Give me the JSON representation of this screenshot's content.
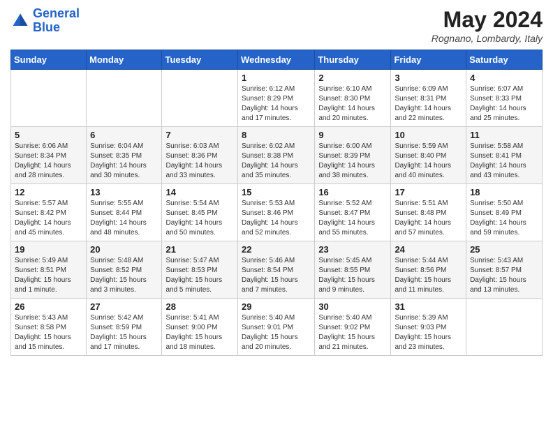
{
  "header": {
    "logo_line1": "General",
    "logo_line2": "Blue",
    "month_year": "May 2024",
    "location": "Rognano, Lombardy, Italy"
  },
  "weekdays": [
    "Sunday",
    "Monday",
    "Tuesday",
    "Wednesday",
    "Thursday",
    "Friday",
    "Saturday"
  ],
  "weeks": [
    [
      {
        "day": "",
        "sunrise": "",
        "sunset": "",
        "daylight": ""
      },
      {
        "day": "",
        "sunrise": "",
        "sunset": "",
        "daylight": ""
      },
      {
        "day": "",
        "sunrise": "",
        "sunset": "",
        "daylight": ""
      },
      {
        "day": "1",
        "sunrise": "Sunrise: 6:12 AM",
        "sunset": "Sunset: 8:29 PM",
        "daylight": "Daylight: 14 hours and 17 minutes."
      },
      {
        "day": "2",
        "sunrise": "Sunrise: 6:10 AM",
        "sunset": "Sunset: 8:30 PM",
        "daylight": "Daylight: 14 hours and 20 minutes."
      },
      {
        "day": "3",
        "sunrise": "Sunrise: 6:09 AM",
        "sunset": "Sunset: 8:31 PM",
        "daylight": "Daylight: 14 hours and 22 minutes."
      },
      {
        "day": "4",
        "sunrise": "Sunrise: 6:07 AM",
        "sunset": "Sunset: 8:33 PM",
        "daylight": "Daylight: 14 hours and 25 minutes."
      }
    ],
    [
      {
        "day": "5",
        "sunrise": "Sunrise: 6:06 AM",
        "sunset": "Sunset: 8:34 PM",
        "daylight": "Daylight: 14 hours and 28 minutes."
      },
      {
        "day": "6",
        "sunrise": "Sunrise: 6:04 AM",
        "sunset": "Sunset: 8:35 PM",
        "daylight": "Daylight: 14 hours and 30 minutes."
      },
      {
        "day": "7",
        "sunrise": "Sunrise: 6:03 AM",
        "sunset": "Sunset: 8:36 PM",
        "daylight": "Daylight: 14 hours and 33 minutes."
      },
      {
        "day": "8",
        "sunrise": "Sunrise: 6:02 AM",
        "sunset": "Sunset: 8:38 PM",
        "daylight": "Daylight: 14 hours and 35 minutes."
      },
      {
        "day": "9",
        "sunrise": "Sunrise: 6:00 AM",
        "sunset": "Sunset: 8:39 PM",
        "daylight": "Daylight: 14 hours and 38 minutes."
      },
      {
        "day": "10",
        "sunrise": "Sunrise: 5:59 AM",
        "sunset": "Sunset: 8:40 PM",
        "daylight": "Daylight: 14 hours and 40 minutes."
      },
      {
        "day": "11",
        "sunrise": "Sunrise: 5:58 AM",
        "sunset": "Sunset: 8:41 PM",
        "daylight": "Daylight: 14 hours and 43 minutes."
      }
    ],
    [
      {
        "day": "12",
        "sunrise": "Sunrise: 5:57 AM",
        "sunset": "Sunset: 8:42 PM",
        "daylight": "Daylight: 14 hours and 45 minutes."
      },
      {
        "day": "13",
        "sunrise": "Sunrise: 5:55 AM",
        "sunset": "Sunset: 8:44 PM",
        "daylight": "Daylight: 14 hours and 48 minutes."
      },
      {
        "day": "14",
        "sunrise": "Sunrise: 5:54 AM",
        "sunset": "Sunset: 8:45 PM",
        "daylight": "Daylight: 14 hours and 50 minutes."
      },
      {
        "day": "15",
        "sunrise": "Sunrise: 5:53 AM",
        "sunset": "Sunset: 8:46 PM",
        "daylight": "Daylight: 14 hours and 52 minutes."
      },
      {
        "day": "16",
        "sunrise": "Sunrise: 5:52 AM",
        "sunset": "Sunset: 8:47 PM",
        "daylight": "Daylight: 14 hours and 55 minutes."
      },
      {
        "day": "17",
        "sunrise": "Sunrise: 5:51 AM",
        "sunset": "Sunset: 8:48 PM",
        "daylight": "Daylight: 14 hours and 57 minutes."
      },
      {
        "day": "18",
        "sunrise": "Sunrise: 5:50 AM",
        "sunset": "Sunset: 8:49 PM",
        "daylight": "Daylight: 14 hours and 59 minutes."
      }
    ],
    [
      {
        "day": "19",
        "sunrise": "Sunrise: 5:49 AM",
        "sunset": "Sunset: 8:51 PM",
        "daylight": "Daylight: 15 hours and 1 minute."
      },
      {
        "day": "20",
        "sunrise": "Sunrise: 5:48 AM",
        "sunset": "Sunset: 8:52 PM",
        "daylight": "Daylight: 15 hours and 3 minutes."
      },
      {
        "day": "21",
        "sunrise": "Sunrise: 5:47 AM",
        "sunset": "Sunset: 8:53 PM",
        "daylight": "Daylight: 15 hours and 5 minutes."
      },
      {
        "day": "22",
        "sunrise": "Sunrise: 5:46 AM",
        "sunset": "Sunset: 8:54 PM",
        "daylight": "Daylight: 15 hours and 7 minutes."
      },
      {
        "day": "23",
        "sunrise": "Sunrise: 5:45 AM",
        "sunset": "Sunset: 8:55 PM",
        "daylight": "Daylight: 15 hours and 9 minutes."
      },
      {
        "day": "24",
        "sunrise": "Sunrise: 5:44 AM",
        "sunset": "Sunset: 8:56 PM",
        "daylight": "Daylight: 15 hours and 11 minutes."
      },
      {
        "day": "25",
        "sunrise": "Sunrise: 5:43 AM",
        "sunset": "Sunset: 8:57 PM",
        "daylight": "Daylight: 15 hours and 13 minutes."
      }
    ],
    [
      {
        "day": "26",
        "sunrise": "Sunrise: 5:43 AM",
        "sunset": "Sunset: 8:58 PM",
        "daylight": "Daylight: 15 hours and 15 minutes."
      },
      {
        "day": "27",
        "sunrise": "Sunrise: 5:42 AM",
        "sunset": "Sunset: 8:59 PM",
        "daylight": "Daylight: 15 hours and 17 minutes."
      },
      {
        "day": "28",
        "sunrise": "Sunrise: 5:41 AM",
        "sunset": "Sunset: 9:00 PM",
        "daylight": "Daylight: 15 hours and 18 minutes."
      },
      {
        "day": "29",
        "sunrise": "Sunrise: 5:40 AM",
        "sunset": "Sunset: 9:01 PM",
        "daylight": "Daylight: 15 hours and 20 minutes."
      },
      {
        "day": "30",
        "sunrise": "Sunrise: 5:40 AM",
        "sunset": "Sunset: 9:02 PM",
        "daylight": "Daylight: 15 hours and 21 minutes."
      },
      {
        "day": "31",
        "sunrise": "Sunrise: 5:39 AM",
        "sunset": "Sunset: 9:03 PM",
        "daylight": "Daylight: 15 hours and 23 minutes."
      },
      {
        "day": "",
        "sunrise": "",
        "sunset": "",
        "daylight": ""
      }
    ]
  ]
}
